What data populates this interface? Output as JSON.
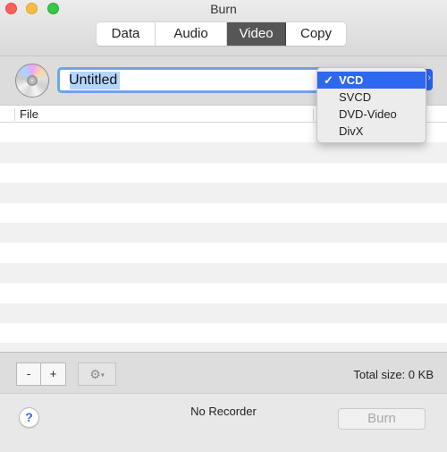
{
  "window": {
    "title": "Burn"
  },
  "tabs": [
    {
      "label": "Data",
      "active": false
    },
    {
      "label": "Audio",
      "active": false
    },
    {
      "label": "Video",
      "active": true
    },
    {
      "label": "Copy",
      "active": false
    }
  ],
  "header": {
    "disc_icon": "cd-disc-icon",
    "name_value": "Untitled",
    "format_selected": "VCD"
  },
  "format_menu": {
    "items": [
      {
        "label": "VCD",
        "checked": true
      },
      {
        "label": "SVCD",
        "checked": false
      },
      {
        "label": "DVD-Video",
        "checked": false
      },
      {
        "label": "DivX",
        "checked": false
      }
    ],
    "check_glyph": "✓"
  },
  "table": {
    "columns": [
      {
        "label": "File"
      }
    ],
    "rows": []
  },
  "toolbar": {
    "remove_label": "-",
    "add_label": "+",
    "gear_glyph": "⚙",
    "caret_glyph": "▾",
    "total_size": "Total size: 0 KB"
  },
  "bottom": {
    "help_label": "?",
    "recorder_status": "No Recorder",
    "burn_label": "Burn"
  },
  "colors": {
    "accent": "#2d68ee",
    "focus_ring": "#6aa6e6",
    "selection": "#b4d5fe",
    "active_tab": "#565656"
  }
}
